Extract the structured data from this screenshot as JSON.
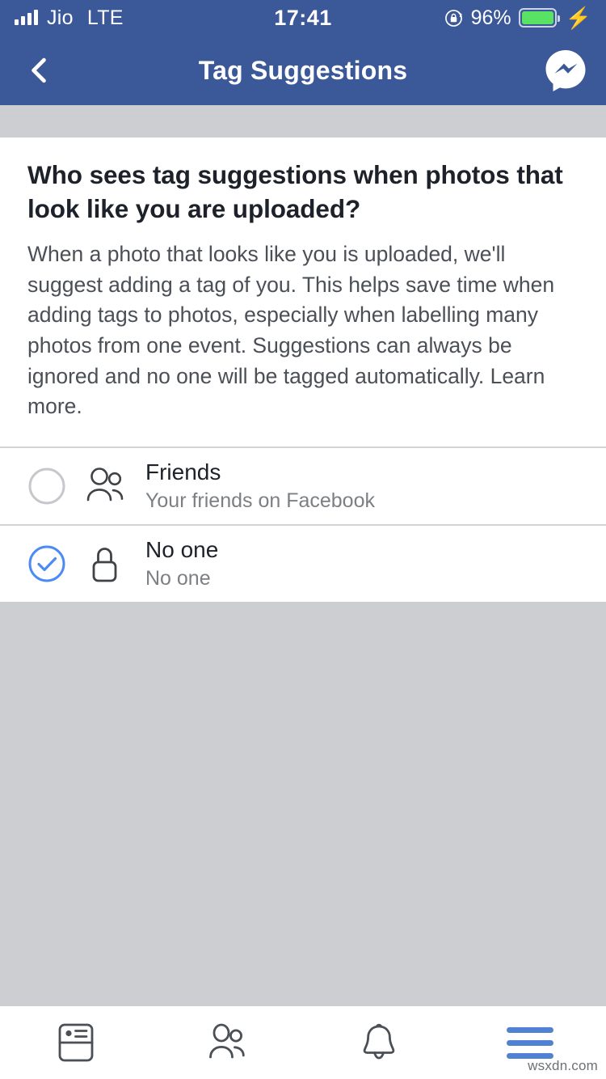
{
  "statusbar": {
    "carrier": "Jio",
    "network": "LTE",
    "time": "17:41",
    "battery_percent": "96%",
    "rotation_lock_icon": "rotation-lock-icon",
    "battery_icon": "battery-icon",
    "charging_icon": "charging-bolt-icon",
    "signal_icon": "signal-bars-icon"
  },
  "navbar": {
    "back_icon": "chevron-left-icon",
    "title": "Tag Suggestions",
    "messenger_icon": "messenger-icon"
  },
  "content": {
    "heading": "Who sees tag suggestions when photos that look like you are uploaded?",
    "body": "When a photo that looks like you is uploaded, we'll suggest adding a tag of you. This helps save time when adding tags to photos, especially when labelling many photos from one event. Suggestions can always be ignored and no one will be tagged automatically. Learn more."
  },
  "options": [
    {
      "title": "Friends",
      "subtitle": "Your friends on Facebook",
      "icon": "friends-icon",
      "selected": false,
      "radio_icon": "radio-unselected-icon"
    },
    {
      "title": "No one",
      "subtitle": "No one",
      "icon": "lock-icon",
      "selected": true,
      "radio_icon": "radio-selected-check-icon"
    }
  ],
  "tabbar": {
    "items": [
      {
        "name": "news-feed-icon",
        "active": false
      },
      {
        "name": "friends-icon",
        "active": false
      },
      {
        "name": "notifications-bell-icon",
        "active": false
      },
      {
        "name": "menu-hamburger-icon",
        "active": true
      }
    ]
  },
  "watermark": "wsxdn.com",
  "colors": {
    "header_blue": "#3b5998",
    "accent_blue": "#4c8bf5",
    "tab_active_blue": "#5181d4",
    "page_gray": "#cdced2",
    "battery_green": "#5ae265",
    "text_dark": "#1d2129",
    "text_body": "#4b4f56",
    "text_muted": "#7c7f84"
  }
}
